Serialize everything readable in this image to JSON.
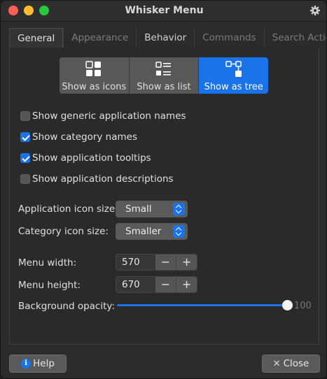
{
  "window": {
    "title": "Whisker Menu"
  },
  "tabs": [
    {
      "label": "General"
    },
    {
      "label": "Appearance"
    },
    {
      "label": "Behavior"
    },
    {
      "label": "Commands"
    },
    {
      "label": "Search Actions"
    }
  ],
  "active_tab": "General",
  "view_modes": [
    {
      "label": "Show as icons",
      "icon": "icons-view-icon",
      "active": false
    },
    {
      "label": "Show as list",
      "icon": "list-view-icon",
      "active": false
    },
    {
      "label": "Show as tree",
      "icon": "tree-view-icon",
      "active": true
    }
  ],
  "checkboxes": [
    {
      "label": "Show generic application names",
      "checked": false
    },
    {
      "label": "Show category names",
      "checked": true
    },
    {
      "label": "Show application tooltips",
      "checked": true
    },
    {
      "label": "Show application descriptions",
      "checked": false
    }
  ],
  "app_icon_size": {
    "label": "Application icon size:",
    "value": "Small"
  },
  "category_icon_size": {
    "label": "Category icon size:",
    "value": "Smaller"
  },
  "menu_width": {
    "label": "Menu width:",
    "value": "570"
  },
  "menu_height": {
    "label": "Menu height:",
    "value": "670"
  },
  "background_opacity": {
    "label": "Background opacity:",
    "value": "100",
    "fraction": 1.0
  },
  "spin_buttons": {
    "minus": "−",
    "plus": "+"
  },
  "footer": {
    "help_label": "Help",
    "close_label": "Close"
  },
  "colors": {
    "accent": "#1a73e8",
    "window_bg": "#2b2b2b",
    "control_bg": "#5a5a5a"
  }
}
